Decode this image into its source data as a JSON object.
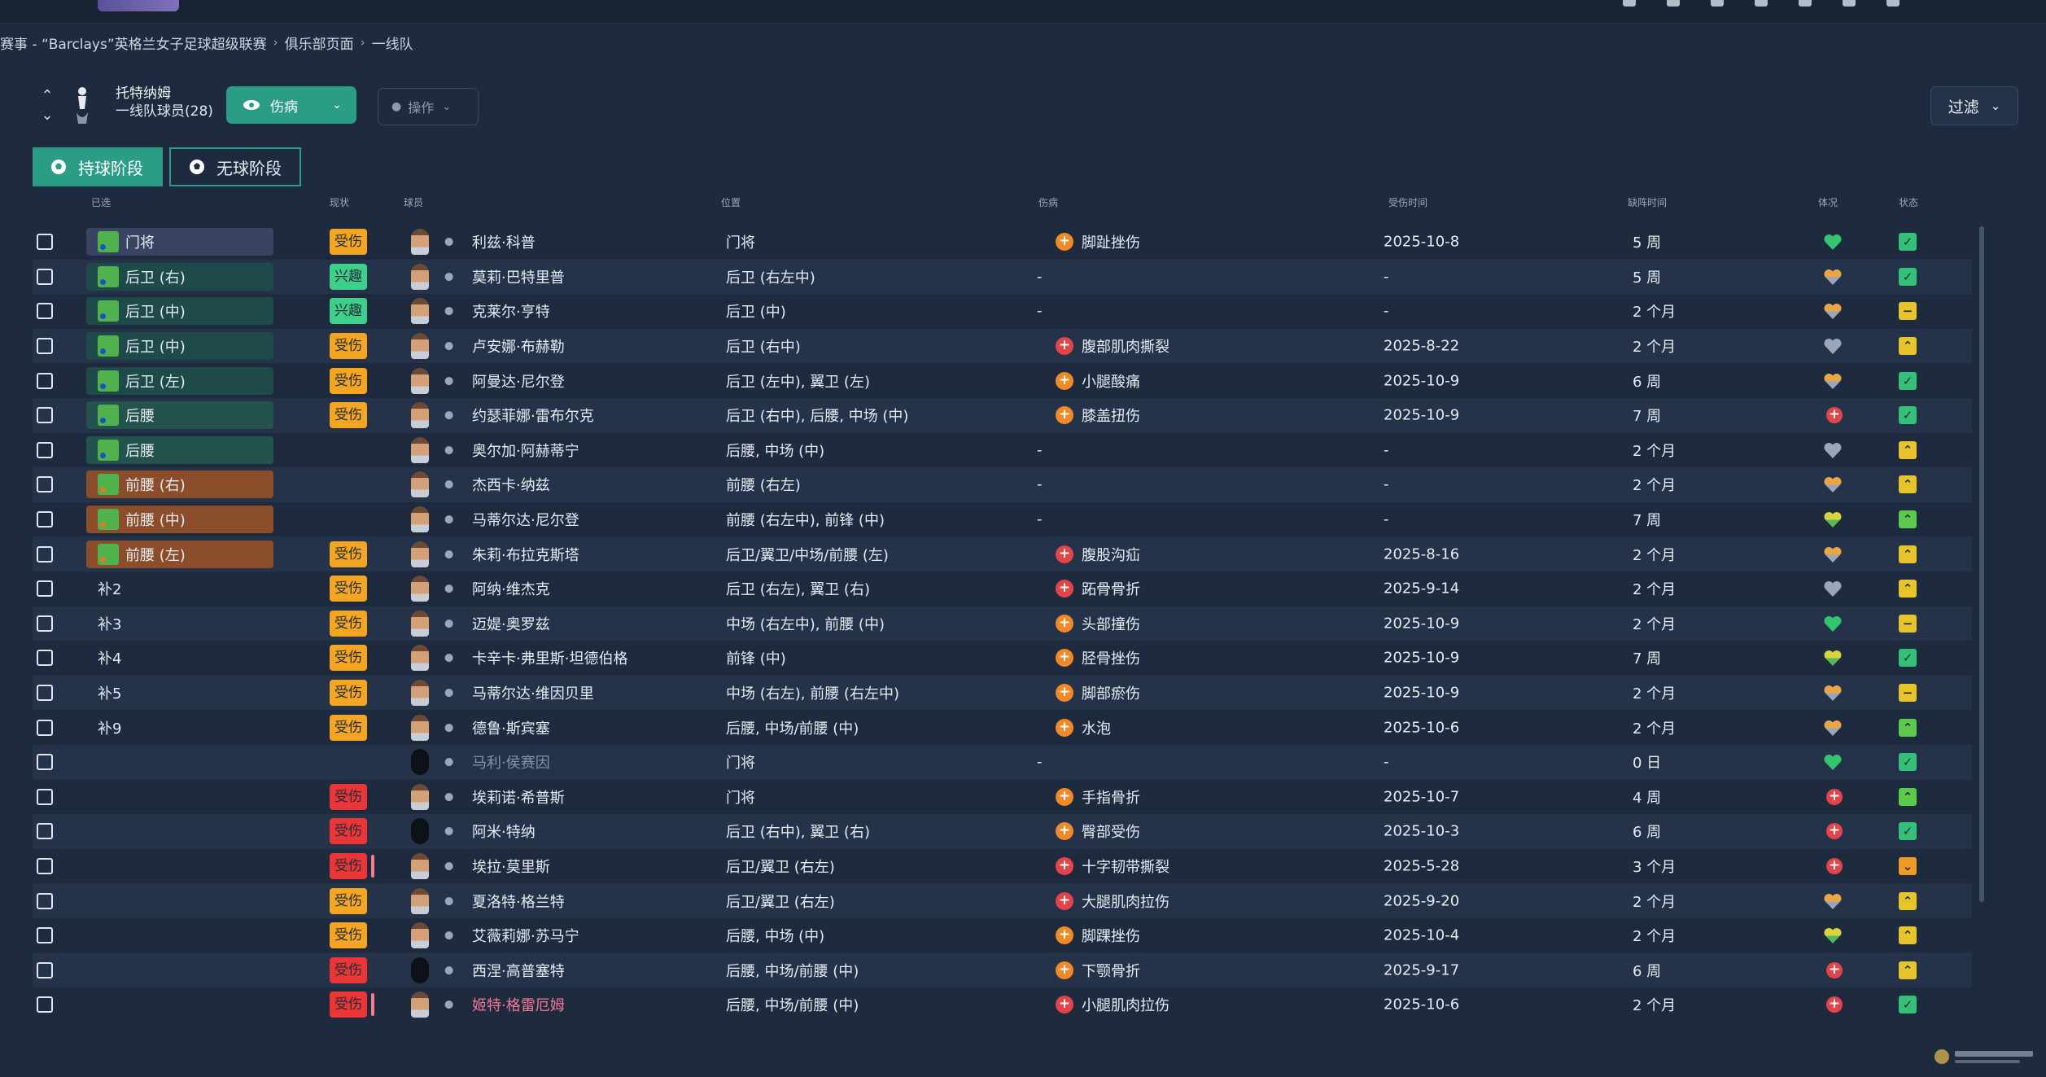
{
  "breadcrumb": {
    "items": [
      "赛事 - “Barclays”英格兰女子足球超级联赛",
      "俱乐部页面",
      "一线队"
    ],
    "sep": "›"
  },
  "club": {
    "name": "托特纳姆",
    "squad_count": "一线队球员(28)"
  },
  "buttons": {
    "view": "伤病",
    "actions": "操作",
    "filter": "过滤"
  },
  "tabs": {
    "in_possession": "持球阶段",
    "out_possession": "无球阶段"
  },
  "columns": {
    "selected": "已选",
    "status_tag": "现状",
    "player": "球员",
    "position": "位置",
    "injury": "伤病",
    "injury_date": "受伤时间",
    "absence": "缺阵时间",
    "condition": "体况",
    "status": "状态"
  },
  "colors": {
    "accent": "#2b9c86",
    "background": "#1e2b3f",
    "injured_badge": "#f4a521",
    "interest_badge": "#3ed08b",
    "serious_badge": "#ea3636",
    "minor_injury_dot": "#f08a28",
    "serious_injury_dot": "#e2444a"
  },
  "rows": [
    {
      "slot": "门将",
      "slot_type": "gk",
      "tag": "受伤",
      "tag_type": "inj",
      "name": "利兹·科普",
      "pos": "门将",
      "injury": "脚趾挫伤",
      "sev": "o",
      "date": "2025-10-8",
      "dur": "5 周",
      "cond": "green",
      "stat": "g"
    },
    {
      "slot": "后卫 (右)",
      "slot_type": "df",
      "tag": "兴趣",
      "tag_type": "int",
      "name": "莫莉·巴特里普",
      "pos": "后卫 (右左中)",
      "injury": "-",
      "sev": "",
      "date": "-",
      "dur": "5 周",
      "cond": "orange",
      "stat": "g"
    },
    {
      "slot": "后卫 (中)",
      "slot_type": "df",
      "tag": "兴趣",
      "tag_type": "int",
      "name": "克莱尔·亨特",
      "pos": "后卫 (中)",
      "injury": "-",
      "sev": "",
      "date": "-",
      "dur": "2 个月",
      "cond": "orange",
      "stat": "y"
    },
    {
      "slot": "后卫 (中)",
      "slot_type": "df",
      "tag": "受伤",
      "tag_type": "inj",
      "name": "卢安娜·布赫勒",
      "pos": "后卫 (右中)",
      "injury": "腹部肌肉撕裂",
      "sev": "r",
      "date": "2025-8-22",
      "dur": "2 个月",
      "cond": "grey",
      "stat": "hy"
    },
    {
      "slot": "后卫 (左)",
      "slot_type": "df",
      "tag": "受伤",
      "tag_type": "inj",
      "name": "阿曼达·尼尔登",
      "pos": "后卫 (左中), 翼卫 (左)",
      "injury": "小腿酸痛",
      "sev": "o",
      "date": "2025-10-9",
      "dur": "6 周",
      "cond": "orange",
      "stat": "g"
    },
    {
      "slot": "后腰",
      "slot_type": "dm",
      "tag": "受伤",
      "tag_type": "inj",
      "name": "约瑟菲娜·雷布尔克",
      "pos": "后卫 (右中), 后腰, 中场 (中)",
      "injury": "膝盖扭伤",
      "sev": "o",
      "date": "2025-10-9",
      "dur": "7 周",
      "cond": "red",
      "stat": "g"
    },
    {
      "slot": "后腰",
      "slot_type": "dm",
      "tag": "",
      "tag_type": "",
      "name": "奥尔加·阿赫蒂宁",
      "pos": "后腰, 中场 (中)",
      "injury": "-",
      "sev": "",
      "date": "-",
      "dur": "2 个月",
      "cond": "grey",
      "stat": "hy"
    },
    {
      "slot": "前腰 (右)",
      "slot_type": "mf",
      "tag": "",
      "tag_type": "",
      "name": "杰西卡·纳兹",
      "pos": "前腰 (右左)",
      "injury": "-",
      "sev": "",
      "date": "-",
      "dur": "2 个月",
      "cond": "orange",
      "stat": "hy"
    },
    {
      "slot": "前腰 (中)",
      "slot_type": "mf",
      "tag": "",
      "tag_type": "",
      "name": "马蒂尔达·尼尔登",
      "pos": "前腰 (右左中), 前锋 (中)",
      "injury": "-",
      "sev": "",
      "date": "-",
      "dur": "7 周",
      "cond": "yellow",
      "stat": "hg"
    },
    {
      "slot": "前腰 (左)",
      "slot_type": "mf",
      "tag": "受伤",
      "tag_type": "inj",
      "name": "朱莉·布拉克斯塔",
      "pos": "后卫/翼卫/中场/前腰 (左)",
      "injury": "腹股沟疝",
      "sev": "r",
      "date": "2025-8-16",
      "dur": "2 个月",
      "cond": "orange",
      "stat": "hy"
    },
    {
      "slot": "补2",
      "slot_type": "sub",
      "tag": "受伤",
      "tag_type": "inj",
      "name": "阿纳·维杰克",
      "pos": "后卫 (右左), 翼卫 (右)",
      "injury": "跖骨骨折",
      "sev": "r",
      "date": "2025-9-14",
      "dur": "2 个月",
      "cond": "grey",
      "stat": "hy"
    },
    {
      "slot": "补3",
      "slot_type": "sub",
      "tag": "受伤",
      "tag_type": "inj",
      "name": "迈媞·奥罗兹",
      "pos": "中场 (右左中), 前腰 (中)",
      "injury": "头部撞伤",
      "sev": "o",
      "date": "2025-10-9",
      "dur": "2 个月",
      "cond": "green",
      "stat": "y"
    },
    {
      "slot": "补4",
      "slot_type": "sub",
      "tag": "受伤",
      "tag_type": "inj",
      "name": "卡辛卡·弗里斯·坦德伯格",
      "pos": "前锋 (中)",
      "injury": "胫骨挫伤",
      "sev": "o",
      "date": "2025-10-9",
      "dur": "7 周",
      "cond": "yellow",
      "stat": "g"
    },
    {
      "slot": "补5",
      "slot_type": "sub",
      "tag": "受伤",
      "tag_type": "inj",
      "name": "马蒂尔达·维因贝里",
      "pos": "中场 (右左), 前腰 (右左中)",
      "injury": "脚部瘀伤",
      "sev": "o",
      "date": "2025-10-9",
      "dur": "2 个月",
      "cond": "orange",
      "stat": "y"
    },
    {
      "slot": "补9",
      "slot_type": "sub",
      "tag": "受伤",
      "tag_type": "inj",
      "name": "德鲁·斯宾塞",
      "pos": "后腰, 中场/前腰 (中)",
      "injury": "水泡",
      "sev": "o",
      "date": "2025-10-6",
      "dur": "2 个月",
      "cond": "orange",
      "stat": "hg"
    },
    {
      "slot": "",
      "slot_type": "sub",
      "tag": "",
      "tag_type": "",
      "name": "马利·侯赛因",
      "name_style": "dim",
      "face": "sil",
      "pos": "门将",
      "injury": "-",
      "sev": "",
      "date": "-",
      "dur": "0 日",
      "cond": "green",
      "stat": "g"
    },
    {
      "slot": "",
      "slot_type": "sub",
      "tag": "受伤",
      "tag_type": "red",
      "name": "埃莉诺·希普斯",
      "pos": "门将",
      "injury": "手指骨折",
      "sev": "o",
      "date": "2025-10-7",
      "dur": "4 周",
      "cond": "red",
      "stat": "hg"
    },
    {
      "slot": "",
      "slot_type": "sub",
      "tag": "受伤",
      "tag_type": "red",
      "name": "阿米·特纳",
      "face": "sil",
      "pos": "后卫 (右中), 翼卫 (右)",
      "injury": "臀部受伤",
      "sev": "o",
      "date": "2025-10-3",
      "dur": "6 周",
      "cond": "red",
      "stat": "g"
    },
    {
      "slot": "",
      "slot_type": "sub",
      "tag": "受伤",
      "tag_type": "red",
      "bar": true,
      "name": "埃拉·莫里斯",
      "pos": "后卫/翼卫 (右左)",
      "injury": "十字韧带撕裂",
      "sev": "r",
      "date": "2025-5-28",
      "dur": "3 个月",
      "cond": "red",
      "stat": "or"
    },
    {
      "slot": "",
      "slot_type": "sub",
      "tag": "受伤",
      "tag_type": "inj",
      "name": "夏洛特·格兰特",
      "pos": "后卫/翼卫 (右左)",
      "injury": "大腿肌肉拉伤",
      "sev": "r",
      "date": "2025-9-20",
      "dur": "2 个月",
      "cond": "orange",
      "stat": "hy"
    },
    {
      "slot": "",
      "slot_type": "sub",
      "tag": "受伤",
      "tag_type": "inj",
      "name": "艾薇莉娜·苏马宁",
      "pos": "后腰, 中场 (中)",
      "injury": "脚踝挫伤",
      "sev": "o",
      "date": "2025-10-4",
      "dur": "2 个月",
      "cond": "yellow",
      "stat": "hy"
    },
    {
      "slot": "",
      "slot_type": "sub",
      "tag": "受伤",
      "tag_type": "red",
      "name": "西涅·高普塞特",
      "face": "sil",
      "pos": "后腰, 中场/前腰 (中)",
      "injury": "下颚骨折",
      "sev": "o",
      "date": "2025-9-17",
      "dur": "6 周",
      "cond": "red",
      "stat": "hy"
    },
    {
      "slot": "",
      "slot_type": "sub",
      "tag": "受伤",
      "tag_type": "red",
      "bar": true,
      "name": "姬特·格雷厄姆",
      "name_style": "pink",
      "pos": "后腰, 中场/前腰 (中)",
      "injury": "小腿肌肉拉伤",
      "sev": "r",
      "date": "2025-10-6",
      "dur": "2 个月",
      "cond": "red",
      "stat": "g"
    }
  ]
}
